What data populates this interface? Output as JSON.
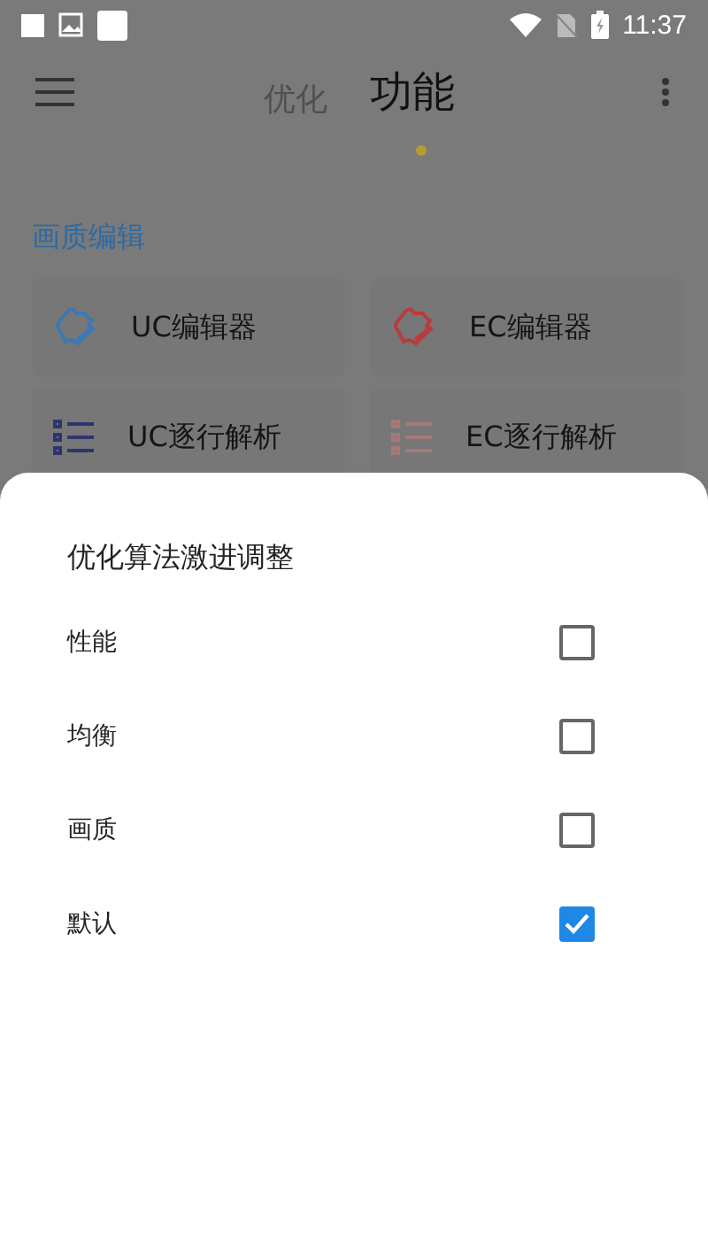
{
  "status_bar": {
    "time": "11:37"
  },
  "tabs": [
    {
      "label": "优化",
      "selected": false
    },
    {
      "label": "功能",
      "selected": true
    }
  ],
  "section": {
    "title": "画质编辑",
    "items": [
      {
        "label": "UC编辑器",
        "kind": "editor",
        "color": "#3d78b4"
      },
      {
        "label": "EC编辑器",
        "kind": "editor",
        "color": "#b83c3c"
      },
      {
        "label": "UC逐行解析",
        "kind": "list",
        "color": "#2e3470"
      },
      {
        "label": "EC逐行解析",
        "kind": "list",
        "color": "#a77878"
      }
    ]
  },
  "dialog": {
    "title": "优化算法激进调整",
    "options": [
      {
        "label": "性能",
        "checked": false
      },
      {
        "label": "均衡",
        "checked": false
      },
      {
        "label": "画质",
        "checked": false
      },
      {
        "label": "默认",
        "checked": true
      }
    ]
  }
}
